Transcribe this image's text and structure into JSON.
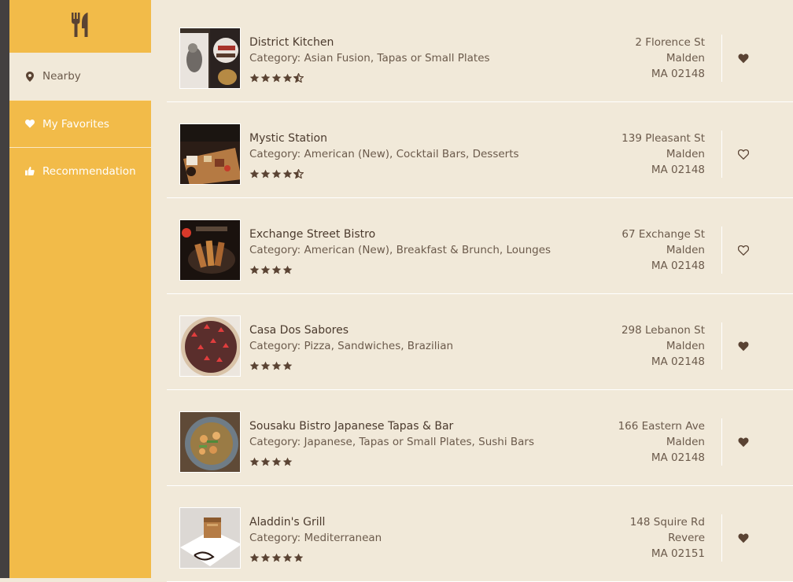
{
  "sidebar": {
    "logo_icon": "utensils-icon",
    "items": [
      {
        "label": "Nearby",
        "icon": "map-marker-icon",
        "active": true
      },
      {
        "label": "My Favorites",
        "icon": "heart-icon",
        "active": false
      },
      {
        "label": "Recommendation",
        "icon": "thumbs-up-icon",
        "active": false
      }
    ]
  },
  "colors": {
    "sidebar": "#f2bb49",
    "background": "#f1e9d9",
    "text": "#5d4a3a",
    "accent_dark": "#5a4333"
  },
  "restaurants": [
    {
      "name": "District Kitchen",
      "category": "Category: Asian Fusion, Tapas or Small Plates",
      "rating": 4.5,
      "street": "2 Florence St",
      "city": "Malden",
      "state_zip": "MA 02148",
      "favorite": true
    },
    {
      "name": "Mystic Station",
      "category": "Category: American (New), Cocktail Bars, Desserts",
      "rating": 4.5,
      "street": "139 Pleasant St",
      "city": "Malden",
      "state_zip": "MA 02148",
      "favorite": false
    },
    {
      "name": "Exchange Street Bistro",
      "category": "Category: American (New), Breakfast & Brunch, Lounges",
      "rating": 4,
      "street": "67 Exchange St",
      "city": "Malden",
      "state_zip": "MA 02148",
      "favorite": false
    },
    {
      "name": "Casa Dos Sabores",
      "category": "Category: Pizza, Sandwiches, Brazilian",
      "rating": 4,
      "street": "298 Lebanon St",
      "city": "Malden",
      "state_zip": "MA 02148",
      "favorite": true
    },
    {
      "name": "Sousaku Bistro Japanese Tapas & Bar",
      "category": "Category: Japanese, Tapas or Small Plates, Sushi Bars",
      "rating": 4,
      "street": "166 Eastern Ave",
      "city": "Malden",
      "state_zip": "MA 02148",
      "favorite": true
    },
    {
      "name": "Aladdin's Grill",
      "category": "Category: Mediterranean",
      "rating": 5,
      "street": "148 Squire Rd",
      "city": "Revere",
      "state_zip": "MA 02151",
      "favorite": true
    }
  ]
}
